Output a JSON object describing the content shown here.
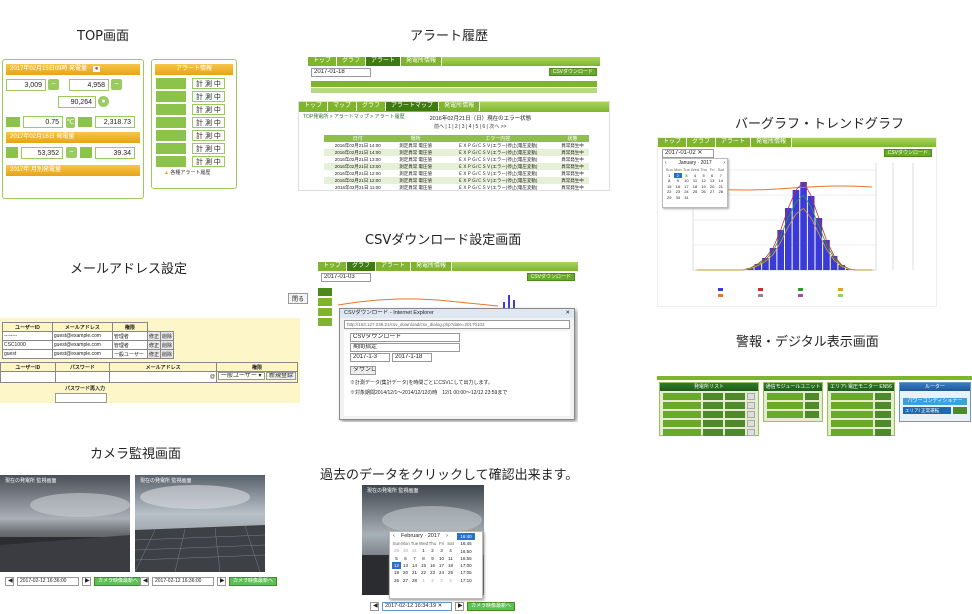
{
  "captions": {
    "top": "TOP画面",
    "alert": "アラート履歴",
    "bar": "バーグラフ・トレンドグラフ",
    "csv": "CSVダウンロード設定画面",
    "mail": "メールアドレス設定",
    "digital": "警報・デジタル表示画面",
    "camera": "カメラ監視画面",
    "past": "過去のデータをクリックして確認出来ます。"
  },
  "top_screen": {
    "header1": "2017年02月15日09時 発電量",
    "v1": "3,009",
    "v2": "4,958",
    "v3": "90,264",
    "v4": "0.75",
    "v4_unit": "℃",
    "v5": "2,318.73",
    "header2": "2017年02月16日 発電量",
    "v6": "53,352",
    "v7": "39.34",
    "header3": "2017年 月別発電量",
    "alarm_title": "アラート情報",
    "alarm_rows": [
      "計 測 中",
      "計 測 中",
      "計 測 中",
      "計 測 中",
      "計 測 中",
      "計 測 中",
      "計 測 中"
    ],
    "alarm_foot": "各種アラート履歴"
  },
  "alert_screen": {
    "tabs": [
      "トップ",
      "グラフ",
      "アラート",
      "発電所情報"
    ],
    "date": "2017-01-18",
    "csv_btn": "CSVダウンロード",
    "tabs2": [
      "トップ",
      "マップ",
      "グラフ",
      "アラートマップ",
      "発電所情報"
    ],
    "breadcrumb": "TOP発電所 > アラートマップ > アラート履歴",
    "status_text": "2016年02月21日（日）現在のエラー状態",
    "pager": "前へ | 1 | 2 | 3 | 4 | 5 | 6 | 次へ >>",
    "columns": [
      "日付",
      "場所",
      "エラー内容",
      "状態"
    ],
    "rows": [
      [
        "2016年02月21日 14:00",
        "測定異常 電圧値",
        "ＥＸＰＧ/ＣＳＶ(エラー)停止(電圧変動)",
        "異常発生中"
      ],
      [
        "2016年02月21日 14:00",
        "測定異常 電圧値",
        "ＥＸＰＧ/ＣＳＶ(エラー)停止(電圧変動)",
        "異常発生中"
      ],
      [
        "2016年02月21日 13:00",
        "測定異常 電圧値",
        "ＥＸＰＧ/ＣＳＶ(エラー)停止(電圧変動)",
        "異常発生中"
      ],
      [
        "2016年02月21日 13:00",
        "測定異常 電圧値",
        "ＥＸＰＧ/ＣＳＶ(エラー)停止(電圧変動)",
        "異常発生中"
      ],
      [
        "2016年02月21日 12:00",
        "測定異常 電圧値",
        "ＥＸＰＧ/ＣＳＶ(エラー)停止(電圧変動)",
        "異常発生中"
      ],
      [
        "2016年02月21日 12:00",
        "測定異常 電圧値",
        "ＥＸＰＧ/ＣＳＶ(エラー)停止(電圧変動)",
        "異常発生中"
      ],
      [
        "2016年02月21日 11:00",
        "測定異常 電圧値",
        "ＥＸＰＧ/ＣＳＶ(エラー)停止(電圧変動)",
        "異常発生中"
      ]
    ]
  },
  "bar_screen": {
    "tabs": [
      "トップ",
      "グラフ",
      "アラート",
      "発電所情報"
    ],
    "date": "2017-01-02",
    "csv_btn": "CSVダウンロード",
    "cal_month": "January",
    "cal_year": "2017",
    "weekdays": [
      "Sun",
      "Mon",
      "Tue",
      "Wed",
      "Thu",
      "Fri",
      "Sat"
    ],
    "days": [
      "1",
      "2",
      "3",
      "4",
      "5",
      "6",
      "7",
      "8",
      "9",
      "10",
      "11",
      "12",
      "13",
      "14",
      "15",
      "16",
      "17",
      "18",
      "19",
      "20",
      "21",
      "22",
      "23",
      "24",
      "25",
      "26",
      "27",
      "28",
      "29",
      "30",
      "31"
    ]
  },
  "csv_screen": {
    "tabs": [
      "トップ",
      "グラフ",
      "アラート",
      "発電所情報"
    ],
    "date": "2017-01-03",
    "csv_btn": "CSVダウンロード",
    "window_title": "CSVダウンロード - Internet Explorer",
    "address": "http://153.127.236.21/csv_download/csv_dialog.php?date=20170103",
    "label1": "CSVダウンロード",
    "label2": "期間指定",
    "from": "2017-1-3",
    "to": "2017-1-18",
    "btn": "ダウンロード",
    "note1": "※計測データ(集計データ)を時間ごとにCSVにして出力します。",
    "note2": "※対象期間2014/12/1〜2014/12/12の時　12/1 00:00〜12/12 23:59まで",
    "side_btn": "閉る"
  },
  "mail_screen": {
    "headers": [
      "ユーザーID",
      "メールアドレス",
      "権限"
    ],
    "rows": [
      [
        "--------",
        "guest@example.com",
        "管理者",
        "修正",
        "削除"
      ],
      [
        "CSC1000",
        "guest@example.com",
        "管理者",
        "修正",
        "削除"
      ],
      [
        "guest",
        "guest@example.com",
        "一般ユーザー",
        "修正",
        "削除"
      ]
    ],
    "new_headers": [
      "ユーザーID",
      "パスワード",
      "メールアドレス",
      "権限"
    ],
    "new_at": "@",
    "role_default": "一般ユーザー",
    "register_btn": "新規登録",
    "pw_confirm": "パスワード再入力"
  },
  "camera_screen": {
    "date1": "2017-02-12 16:36:00",
    "date2": "2017-02-12 16:36:00",
    "btn": "カメラ映像最新へ",
    "overlay1": "現在の発電所 監視画面",
    "overlay2": "現在の発電所 監視画面"
  },
  "past_screen": {
    "overlay": "現在の発電所 監視画面",
    "cal_month": "February",
    "cal_year": "2017",
    "weekdays": [
      "Sun",
      "Mon",
      "Tue",
      "Wed",
      "Thu",
      "Fri",
      "Sat"
    ],
    "days": [
      "29",
      "30",
      "31",
      "1",
      "2",
      "3",
      "4",
      "5",
      "6",
      "7",
      "8",
      "9",
      "10",
      "11",
      "12",
      "13",
      "14",
      "15",
      "16",
      "17",
      "18",
      "19",
      "20",
      "21",
      "22",
      "23",
      "24",
      "25",
      "26",
      "27",
      "28",
      "1",
      "2",
      "3",
      "4"
    ],
    "times": [
      "16:40",
      "16:45",
      "16:50",
      "16:55",
      "17:00",
      "17:05",
      "17:10"
    ],
    "date": "2017-02-12 16:34:19",
    "btn": "カメラ映像最新へ"
  },
  "digital_screen": {
    "p1_title": "発電所リスト",
    "p2_title": "通信モジュールユニット",
    "p3_title": "エリアⅠ 電圧モニター EN56",
    "p4_title": "ルーター",
    "p4_status": "パワーコンディショナー",
    "p4_row": "エリアⅠ 正常運転"
  }
}
